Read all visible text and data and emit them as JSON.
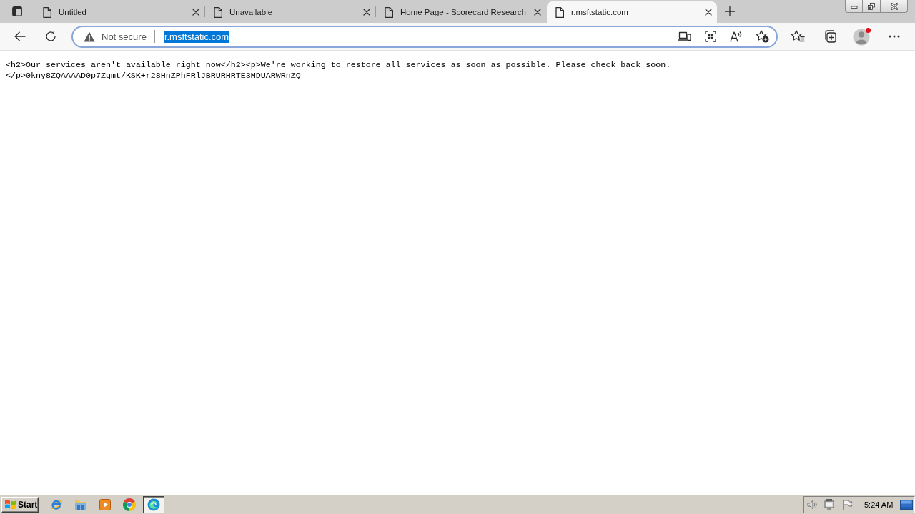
{
  "tabs": [
    {
      "title": "Untitled",
      "selected": false
    },
    {
      "title": "Unavailable",
      "selected": false
    },
    {
      "title": "Home Page - Scorecard Research",
      "selected": false
    },
    {
      "title": "r.msftstatic.com",
      "selected": true
    }
  ],
  "address_bar": {
    "focused": true,
    "security": "Not secure",
    "url": "r.msftstatic.com",
    "url_selected": true
  },
  "page": {
    "text": "<h2>Our services aren't available right now</h2><p>We're working to restore all services as soon as possible. Please check back soon. </p>0kny8ZQAAAAD0p7Zqmt/KSK+r28HnZPhFRlJBRURHRTE3MDUARWRnZQ=="
  },
  "taskbar": {
    "start": "Start",
    "apps": [
      {
        "kind": "e_browser",
        "active": false
      },
      {
        "kind": "folder",
        "active": false
      },
      {
        "kind": "player",
        "active": false
      },
      {
        "kind": "ring_browser",
        "active": false
      },
      {
        "kind": "wave_browser",
        "active": true
      }
    ],
    "clock": "5:24 AM"
  }
}
